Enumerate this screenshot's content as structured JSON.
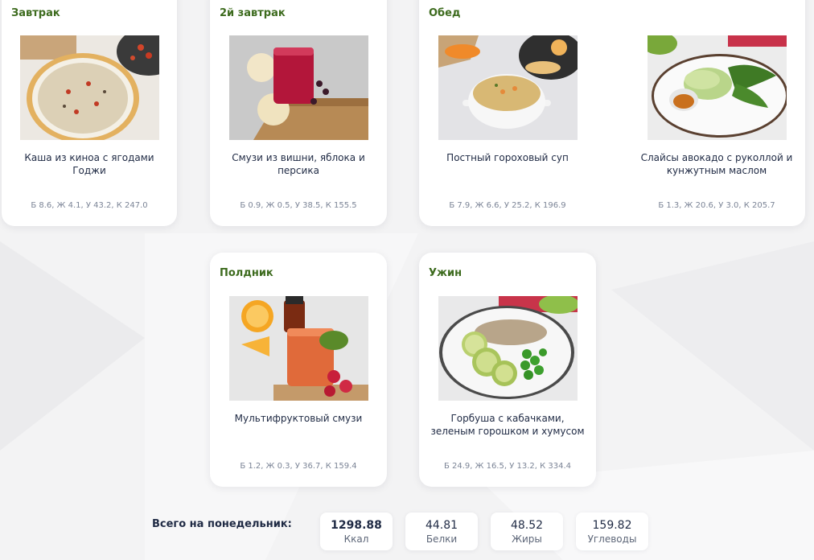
{
  "sections": {
    "breakfast": {
      "title": "Завтрак",
      "meals": [
        {
          "name": "Каша из киноа с ягодами Годжи",
          "macros": "Б 8.6, Ж 4.1, У 43.2, К 247.0",
          "photo": "quinoa-porridge-photo"
        }
      ]
    },
    "second_breakfast": {
      "title": "2й завтрак",
      "meals": [
        {
          "name": "Смузи из вишни, яблока и персика",
          "macros": "Б 0.9, Ж 0.5, У 38.5, К 155.5",
          "photo": "cherry-smoothie-photo"
        }
      ]
    },
    "lunch": {
      "title": "Обед",
      "meals": [
        {
          "name": "Постный гороховый суп",
          "macros": "Б 7.9, Ж 6.6, У 25.2, К 196.9",
          "photo": "pea-soup-photo"
        },
        {
          "name": "Слайсы авокадо с руколлой и кунжутным маслом",
          "macros": "Б 1.3, Ж 20.6, У 3.0, К 205.7",
          "photo": "avocado-slices-photo"
        }
      ]
    },
    "snack": {
      "title": "Полдник",
      "meals": [
        {
          "name": "Мультифруктовый смузи",
          "macros": "Б 1.2, Ж 0.3, У 36.7, К 159.4",
          "photo": "multifruit-smoothie-photo"
        }
      ]
    },
    "dinner": {
      "title": "Ужин",
      "meals": [
        {
          "name": "Горбуша с кабачками, зеленым горошком и хумусом",
          "macros": "Б 24.9, Ж 16.5, У 13.2, К 334.4",
          "photo": "salmon-zucchini-photo"
        }
      ]
    }
  },
  "totals": {
    "label": "Всего на понедельник:",
    "items": [
      {
        "value": "1298.88",
        "unit": "Ккал"
      },
      {
        "value": "44.81",
        "unit": "Белки"
      },
      {
        "value": "48.52",
        "unit": "Жиры"
      },
      {
        "value": "159.82",
        "unit": "Углеводы"
      }
    ]
  },
  "colors": {
    "section_title": "#3d6b1e",
    "text": "#1f2a44",
    "macros": "#7b8496",
    "background": "#f3f3f4"
  }
}
